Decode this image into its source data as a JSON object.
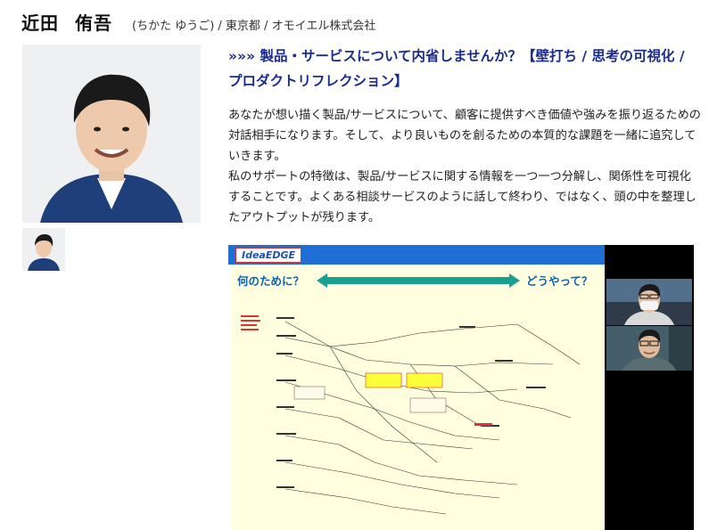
{
  "profile": {
    "name_family": "近田",
    "name_given": "侑吾",
    "meta": "(ちかた ゆうご) / 東京都 / オモイエル株式会社"
  },
  "headline": {
    "arrows": "»»»",
    "text": " 製品・サービスについて内省しませんか？【壁打ち / 思考の可視化 / プロダクトリフレクション】"
  },
  "description": {
    "para1": "あなたが想い描く製品/サービスについて、顧客に提供すべき価値や強みを振り返るための対話相手になります。そして、より良いものを創るための本質的な課題を一緒に追究していきます。",
    "para2": "私のサポートの特徴は、製品/サービスに関する情報を一つ一つ分解し、関係性を可視化することです。よくある相談サービスのように話して終わり、ではなく、頭の中を整理したアウトプットが残ります。"
  },
  "meeting": {
    "logo": "IdeaEDGE",
    "question_left": "何のために？",
    "question_right": "どうやって？"
  },
  "colors": {
    "headline": "#1b2d8c",
    "slide_bar": "#1f6ed4",
    "teal_arrow": "#1aa08f"
  }
}
